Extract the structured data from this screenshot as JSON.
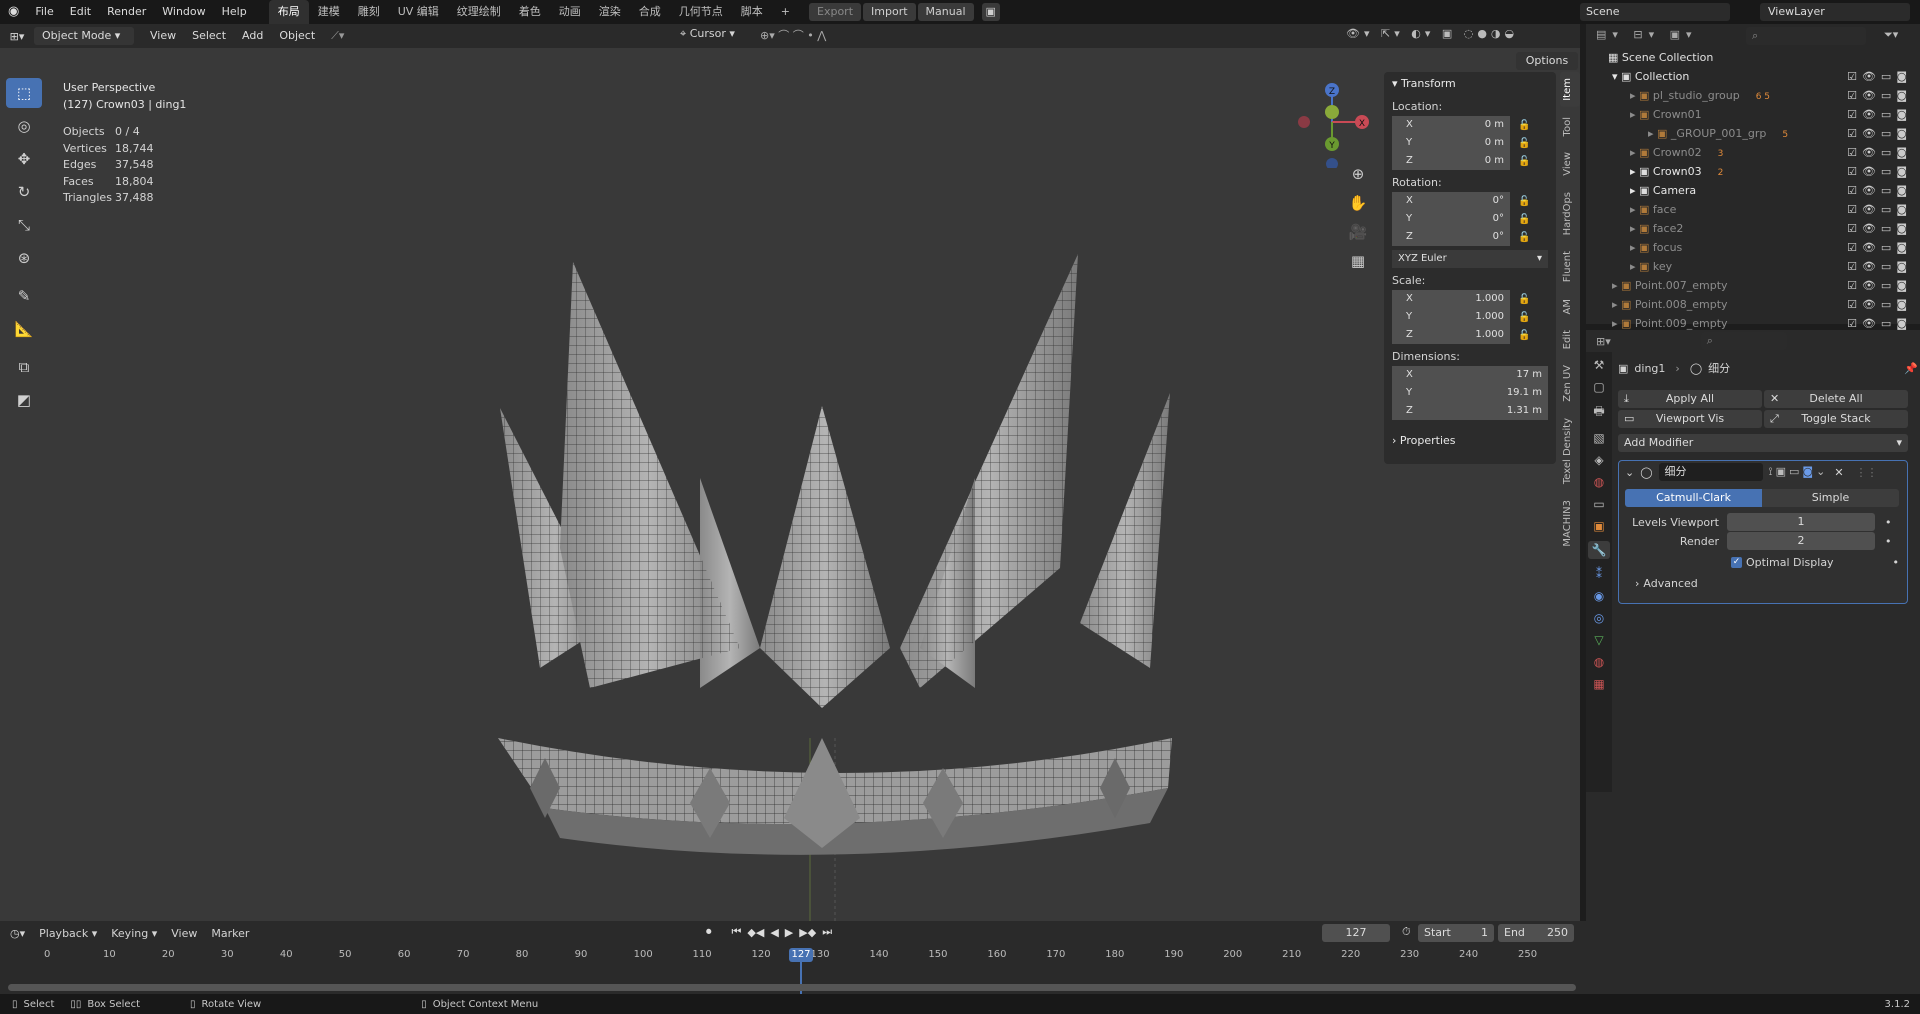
{
  "topbar": {
    "menus": [
      "File",
      "Edit",
      "Render",
      "Window",
      "Help"
    ],
    "workspace_tabs": [
      "布局",
      "建模",
      "雕刻",
      "UV 编辑",
      "纹理绘制",
      "着色",
      "动画",
      "渲染",
      "合成",
      "几何节点",
      "脚本"
    ],
    "active_tab_index": 0,
    "add_tab": "+",
    "export": "Export",
    "import": "Import",
    "manual": "Manual",
    "scene": "Scene",
    "view_layer": "ViewLayer"
  },
  "viewport_header": {
    "mode": "Object Mode",
    "menus": [
      "View",
      "Select",
      "Add",
      "Object"
    ],
    "pivot": "Cursor",
    "options": "Options"
  },
  "overlay": {
    "view_name": "User Perspective",
    "object_info": "(127) Crown03 | ding1",
    "stats": [
      {
        "label": "Objects",
        "value": "0 / 4"
      },
      {
        "label": "Vertices",
        "value": "18,744"
      },
      {
        "label": "Edges",
        "value": "37,548"
      },
      {
        "label": "Faces",
        "value": "18,804"
      },
      {
        "label": "Triangles",
        "value": "37,488"
      }
    ],
    "gizmo": {
      "x": "X",
      "y": "Y",
      "z": "Z"
    }
  },
  "npanel": {
    "header": "Transform",
    "location_label": "Location:",
    "location": [
      {
        "axis": "X",
        "value": "0 m"
      },
      {
        "axis": "Y",
        "value": "0 m"
      },
      {
        "axis": "Z",
        "value": "0 m"
      }
    ],
    "rotation_label": "Rotation:",
    "rotation": [
      {
        "axis": "X",
        "value": "0°"
      },
      {
        "axis": "Y",
        "value": "0°"
      },
      {
        "axis": "Z",
        "value": "0°"
      }
    ],
    "rotation_mode": "XYZ Euler",
    "scale_label": "Scale:",
    "scale": [
      {
        "axis": "X",
        "value": "1.000"
      },
      {
        "axis": "Y",
        "value": "1.000"
      },
      {
        "axis": "Z",
        "value": "1.000"
      }
    ],
    "dimensions_label": "Dimensions:",
    "dimensions": [
      {
        "axis": "X",
        "value": "17 m"
      },
      {
        "axis": "Y",
        "value": "19.1 m"
      },
      {
        "axis": "Z",
        "value": "1.31 m"
      }
    ],
    "properties": "Properties",
    "tabs": [
      "Item",
      "Tool",
      "View",
      "HardOps",
      "Fluent",
      "AM",
      "Edit",
      "Zen UV",
      "Texel Density",
      "MACHIN3"
    ]
  },
  "outliner": {
    "root": "Scene Collection",
    "rows": [
      {
        "name": "Collection",
        "indent": 1,
        "bright": true
      },
      {
        "name": "pl_studio_group",
        "indent": 2,
        "bright": false,
        "badge": "6  5"
      },
      {
        "name": "Crown01",
        "indent": 2,
        "bright": false
      },
      {
        "name": "_GROUP_001_grp",
        "indent": 3,
        "bright": false,
        "badge": "5"
      },
      {
        "name": "Crown02",
        "indent": 2,
        "bright": false,
        "badge": "3"
      },
      {
        "name": "Crown03",
        "indent": 2,
        "bright": true,
        "badge": "2"
      },
      {
        "name": "Camera",
        "indent": 2,
        "bright": true
      },
      {
        "name": "face",
        "indent": 2,
        "bright": false
      },
      {
        "name": "face2",
        "indent": 2,
        "bright": false
      },
      {
        "name": "focus",
        "indent": 2,
        "bright": false
      },
      {
        "name": "key",
        "indent": 2,
        "bright": false
      },
      {
        "name": "Point.007_empty",
        "indent": 1,
        "bright": false
      },
      {
        "name": "Point.008_empty",
        "indent": 1,
        "bright": false
      },
      {
        "name": "Point.009_empty",
        "indent": 1,
        "bright": false
      }
    ]
  },
  "properties": {
    "breadcrumb_object": "ding1",
    "breadcrumb_modifier": "细分",
    "apply_all": "Apply All",
    "delete_all": "Delete All",
    "viewport_vis": "Viewport Vis",
    "toggle_stack": "Toggle Stack",
    "add_modifier": "Add Modifier",
    "modifier_name": "细分",
    "catmull": "Catmull-Clark",
    "simple": "Simple",
    "levels_viewport_label": "Levels Viewport",
    "levels_viewport": "1",
    "render_label": "Render",
    "render": "2",
    "optimal_display": "Optimal Display",
    "advanced": "Advanced"
  },
  "timeline": {
    "menus": [
      "Playback",
      "Keying",
      "View",
      "Marker"
    ],
    "current_frame": "127",
    "start_label": "Start",
    "start": "1",
    "end_label": "End",
    "end": "250",
    "ticks": [
      "0",
      "10",
      "20",
      "30",
      "40",
      "50",
      "60",
      "70",
      "80",
      "90",
      "100",
      "110",
      "120",
      "130",
      "140",
      "150",
      "160",
      "170",
      "180",
      "190",
      "200",
      "210",
      "220",
      "230",
      "240",
      "250"
    ]
  },
  "statusbar": {
    "select": "Select",
    "box_select": "Box Select",
    "rotate_view": "Rotate View",
    "context_menu": "Object Context Menu",
    "version": "3.1.2"
  }
}
